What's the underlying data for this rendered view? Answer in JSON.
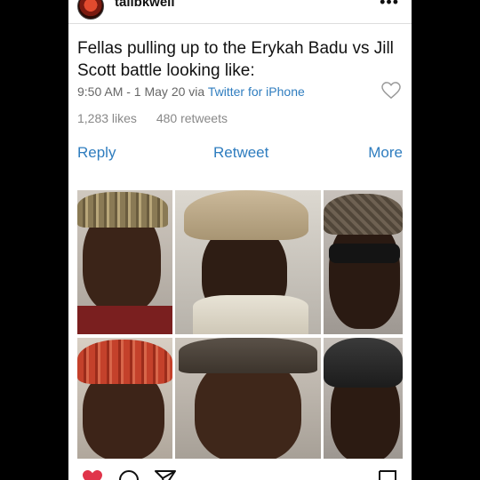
{
  "post": {
    "username": "talibkweli",
    "more_icon": "more-dots-icon"
  },
  "tweet": {
    "text": "Fellas pulling up to the Erykah Badu vs Jill Scott battle looking like:",
    "time": "9:50 AM - 1 May 20 via ",
    "via": "Twitter for iPhone",
    "likes": "1,283 likes",
    "retweets": "480 retweets",
    "actions": {
      "reply": "Reply",
      "retweet": "Retweet",
      "more": "More"
    }
  },
  "colors": {
    "link": "#2f7dbf",
    "like_red": "#e0344a"
  },
  "bottom_bar_icons": [
    "heart-icon",
    "comment-icon",
    "share-icon",
    "bookmark-icon"
  ]
}
